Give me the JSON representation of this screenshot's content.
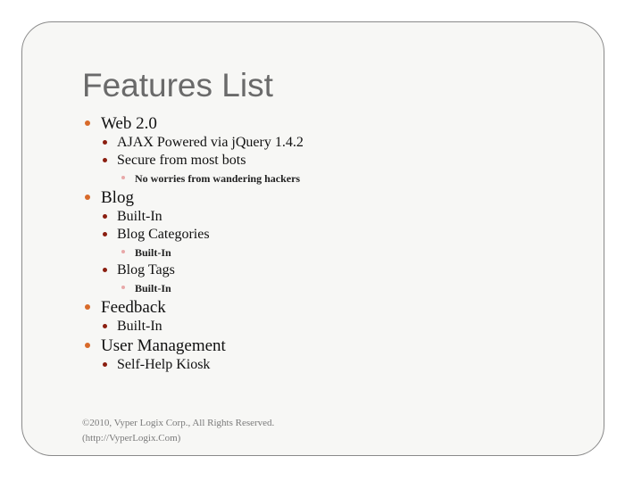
{
  "slide": {
    "title": "Features List",
    "items": [
      {
        "label": "Web 2.0",
        "children": [
          {
            "label": "AJAX Powered via jQuery 1.4.2",
            "children": []
          },
          {
            "label": "Secure from most bots",
            "children": [
              {
                "label": "No worries from wandering hackers"
              }
            ]
          }
        ]
      },
      {
        "label": "Blog",
        "children": [
          {
            "label": "Built-In",
            "children": []
          },
          {
            "label": "Blog Categories",
            "children": [
              {
                "label": "Built-In"
              }
            ]
          },
          {
            "label": "Blog Tags",
            "children": [
              {
                "label": "Built-In"
              }
            ]
          }
        ]
      },
      {
        "label": "Feedback",
        "children": [
          {
            "label": "Built-In",
            "children": []
          }
        ]
      },
      {
        "label": "User Management",
        "children": [
          {
            "label": "Self-Help Kiosk",
            "children": []
          }
        ]
      }
    ],
    "footer": {
      "line1": "©2010, Vyper Logix Corp., All Rights Reserved.",
      "line2": "(http://VyperLogix.Com)"
    }
  },
  "colors": {
    "bullet_level1": "#d86a2a",
    "bullet_level2": "#8b1e10",
    "bullet_level3": "#e8a8a8",
    "title": "#6a6a6a"
  }
}
